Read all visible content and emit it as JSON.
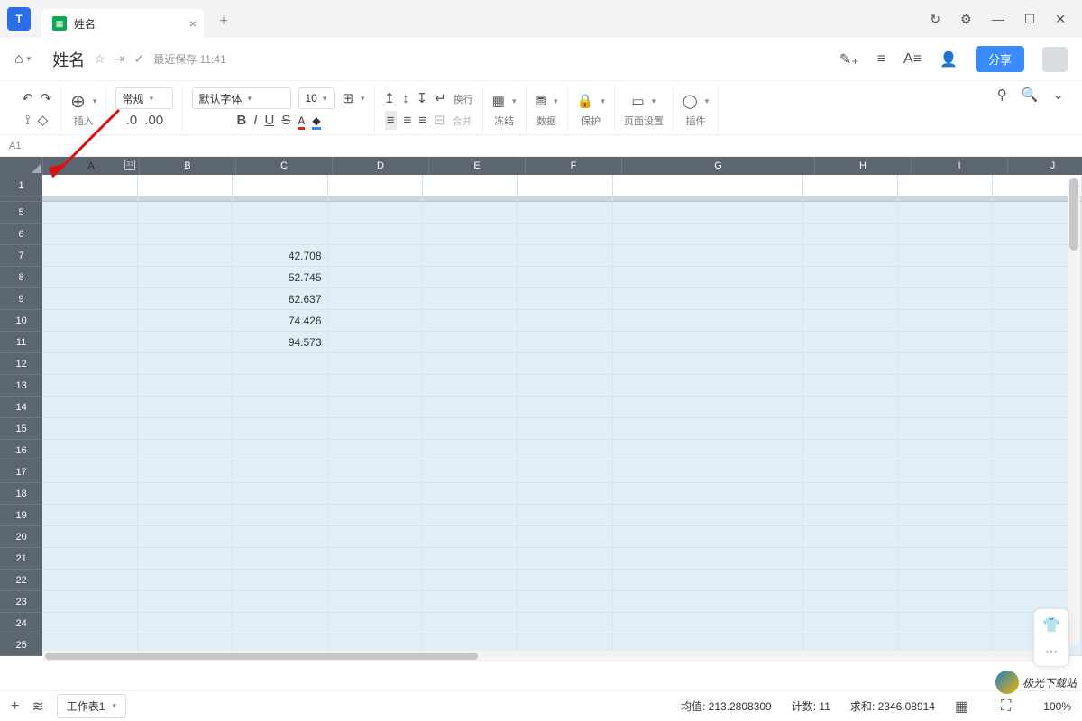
{
  "titlebar": {
    "tab_title": "姓名",
    "close": "×",
    "add": "+"
  },
  "window": {
    "sync": "↻",
    "settings": "⚙",
    "min": "—",
    "max": "☐",
    "close": "✕"
  },
  "header": {
    "title": "姓名",
    "save_status": "最近保存 11:41",
    "share": "分享"
  },
  "toolbar": {
    "insert_label": "插入",
    "format_sel": "常规",
    "decimal": ".0 .00",
    "font_sel": "默认字体",
    "size_sel": "10",
    "wrap": "换行",
    "merge": "合并",
    "freeze": "冻结",
    "data": "数据",
    "protect": "保护",
    "page": "页面设置",
    "plugin": "插件"
  },
  "namebox": "A1",
  "columns": [
    "A",
    "B",
    "C",
    "D",
    "E",
    "F",
    "G",
    "H",
    "I",
    "J"
  ],
  "visible_rows": [
    "1",
    "5",
    "6",
    "7",
    "8",
    "9",
    "10",
    "11",
    "12",
    "13",
    "14",
    "15",
    "16",
    "17",
    "18",
    "19",
    "20",
    "21",
    "22",
    "23",
    "24",
    "25"
  ],
  "cells": {
    "C7": "42.708",
    "C8": "52.745",
    "C9": "62.637",
    "C10": "74.426",
    "C11": "94.573"
  },
  "status": {
    "sheet": "工作表1",
    "avg_lbl": "均值:",
    "avg": "213.2808309",
    "cnt_lbl": "计数:",
    "cnt": "11",
    "sum_lbl": "求和:",
    "sum": "2346.08914",
    "zoom": "100%"
  },
  "watermark": "极光下载站"
}
